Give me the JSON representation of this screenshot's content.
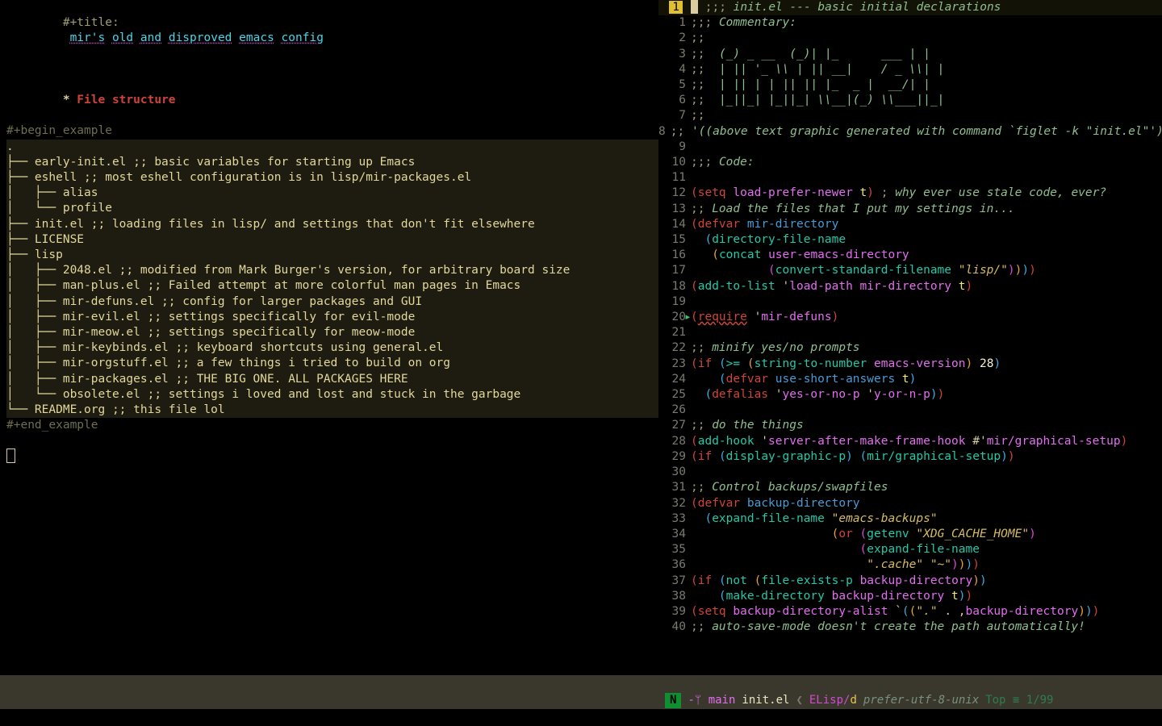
{
  "left": {
    "title_prefix": "#+title:",
    "title_words": [
      "mir's",
      "old",
      "and",
      "disproved",
      "emacs",
      "config"
    ],
    "heading_star": "*",
    "heading_text": " File structure",
    "begin_example": "#+begin_example",
    "end_example": "#+end_example",
    "example_lines": [
      ".",
      "├── early-init.el ;; basic variables for starting up Emacs",
      "├── eshell ;; most eshell configuration is in lisp/mir-packages.el",
      "│   ├── alias",
      "│   └── profile",
      "├── init.el ;; loading files in lisp/ and settings that don't fit elsewhere",
      "├── LICENSE",
      "├── lisp",
      "│   ├── 2048.el ;; modified from Mark Burger's version, for arbitrary board size",
      "│   ├── man-plus.el ;; Failed attempt at more colorful man pages in Emacs",
      "│   ├── mir-defuns.el ;; config for larger packages and GUI",
      "│   ├── mir-evil.el ;; settings specifically for evil-mode",
      "│   ├── mir-meow.el ;; settings specifically for meow-mode",
      "│   ├── mir-keybinds.el ;; keyboard shortcuts using general.el",
      "│   ├── mir-orgstuff.el ;; a few things i tried to build on org",
      "│   ├── mir-packages.el ;; THE BIG ONE. ALL PACKAGES HERE",
      "│   └── obsolete.el ;; settings i loved and lost and stuck in the garbage",
      "└── README.org ;; this file lol"
    ]
  },
  "right": {
    "header_badge": "1",
    "lines": [
      {
        "n": "1",
        "html": "<span class='comment2'>;;;</span> <span class='comment-it'>init.el --- basic initial declarations</span>"
      },
      {
        "n": "1",
        "html": "<span class='comment2'>;;;</span> <span class='comment-it'>Commentary:</span>"
      },
      {
        "n": "2",
        "html": "<span class='comment2'>;;</span>"
      },
      {
        "n": "3",
        "html": "<span class='comment2'>;;</span>  <span class='comment-it'>(_) _ __  (_)| |_      ___ | |</span>"
      },
      {
        "n": "4",
        "html": "<span class='comment2'>;;</span>  <span class='comment-it'>| || '_ \\\\ | || __|    / _ \\\\| |</span>"
      },
      {
        "n": "5",
        "html": "<span class='comment2'>;;</span>  <span class='comment-it'>| || | | || || |_  _ |  __/| |</span>"
      },
      {
        "n": "6",
        "html": "<span class='comment2'>;;</span>  <span class='comment-it'>|_||_| |_||_| \\\\__|(_) \\\\___||_|</span>"
      },
      {
        "n": "7",
        "html": "<span class='comment2'>;;</span>"
      },
      {
        "n": "8",
        "html": "<span class='comment2'>;;</span> <span class='comment-it'>'((above text graphic generated with command `figlet -k \"init.el\"'))</span>"
      },
      {
        "n": "9",
        "html": ""
      },
      {
        "n": "10",
        "html": "<span class='comment2'>;;;</span> <span class='comment-it'>Code:</span>"
      },
      {
        "n": "11",
        "html": ""
      },
      {
        "n": "12",
        "html": "<span class='paren1'>(</span><span class='kw'>setq</span> <span class='var'>load-prefer-newer</span> <span class='const'>t</span><span class='paren1'>)</span> <span class='comment2'>;</span> <span class='comment-it'>why ever use stale code, ever?</span>"
      },
      {
        "n": "13",
        "html": "<span class='comment2'>;;</span> <span class='comment-it'>Load the files that I put my settings in...</span>"
      },
      {
        "n": "14",
        "html": "<span class='paren1'>(</span><span class='kw'>defvar</span> <span class='fn'>mir-directory</span>"
      },
      {
        "n": "15",
        "html": "  <span class='paren2'>(</span><span class='type'>directory-file-name</span>"
      },
      {
        "n": "16",
        "html": "   <span class='paren3'>(</span><span class='type'>concat</span> <span class='var'>user-emacs-directory</span>"
      },
      {
        "n": "17",
        "html": "           <span class='paren4'>(</span><span class='type'>convert-standard-filename</span> <span class='string'>\"lisp/\"</span><span class='paren4'>)</span><span class='paren3'>)</span><span class='paren2'>)</span><span class='paren1'>)</span>"
      },
      {
        "n": "18",
        "html": "<span class='paren1'>(</span><span class='type'>add-to-list</span> '<span class='var'>load-path</span> <span class='var'>mir-directory</span> <span class='const'>t</span><span class='paren1'>)</span>"
      },
      {
        "n": "19",
        "html": ""
      },
      {
        "n": "20",
        "html": "<span class='paren1'>(</span><span class='kw err'>require</span> '<span class='var'>mir-defuns</span><span class='paren1'>)</span>",
        "arrow": true
      },
      {
        "n": "21",
        "html": ""
      },
      {
        "n": "22",
        "html": "<span class='comment2'>;;</span> <span class='comment-it'>minify yes/no prompts</span>"
      },
      {
        "n": "23",
        "html": "<span class='paren1'>(</span><span class='kw'>if</span> <span class='paren2'>(</span><span class='type'>&gt;=</span> <span class='paren3'>(</span><span class='type'>string-to-number</span> <span class='var'>emacs-version</span><span class='paren3'>)</span> <span class='num'>28</span><span class='paren2'>)</span>"
      },
      {
        "n": "24",
        "html": "    <span class='paren2'>(</span><span class='kw'>defvar</span> <span class='fn'>use-short-answers</span> <span class='const'>t</span><span class='paren2'>)</span>"
      },
      {
        "n": "25",
        "html": "  <span class='paren2'>(</span><span class='kw'>defalias</span> '<span class='var'>yes-or-no-p</span> '<span class='var'>y-or-n-p</span><span class='paren2'>)</span><span class='paren1'>)</span>"
      },
      {
        "n": "26",
        "html": ""
      },
      {
        "n": "27",
        "html": "<span class='comment2'>;;</span> <span class='comment-it'>do the things</span>"
      },
      {
        "n": "28",
        "html": "<span class='paren1'>(</span><span class='type'>add-hook</span> '<span class='var'>server-after-make-frame-hook</span> #'<span class='var'>mir/graphical-setup</span><span class='paren1'>)</span>"
      },
      {
        "n": "29",
        "html": "<span class='paren1'>(</span><span class='kw'>if</span> <span class='paren2'>(</span><span class='type'>display-graphic-p</span><span class='paren2'>)</span> <span class='paren2'>(</span><span class='type'>mir/graphical-setup</span><span class='paren2'>)</span><span class='paren1'>)</span>"
      },
      {
        "n": "30",
        "html": ""
      },
      {
        "n": "31",
        "html": "<span class='comment2'>;;</span> <span class='comment-it'>Control backups/swapfiles</span>"
      },
      {
        "n": "32",
        "html": "<span class='paren1'>(</span><span class='kw'>defvar</span> <span class='fn'>backup-directory</span>"
      },
      {
        "n": "33",
        "html": "  <span class='paren2'>(</span><span class='type'>expand-file-name</span> <span class='string'>\"emacs-backups\"</span>"
      },
      {
        "n": "34",
        "html": "                    <span class='paren3'>(</span><span class='kw'>or</span> <span class='paren4'>(</span><span class='type'>getenv</span> <span class='string'>\"XDG_CACHE_HOME\"</span><span class='paren4'>)</span>"
      },
      {
        "n": "35",
        "html": "                        <span class='paren4'>(</span><span class='type'>expand-file-name</span>"
      },
      {
        "n": "36",
        "html": "                         <span class='string'>\".cache\"</span> <span class='string'>\"~\"</span><span class='paren4'>)</span><span class='paren3'>)</span><span class='paren2'>)</span><span class='paren1'>)</span>"
      },
      {
        "n": "37",
        "html": "<span class='paren1'>(</span><span class='kw'>if</span> <span class='paren2'>(</span><span class='type'>not</span> <span class='paren3'>(</span><span class='type'>file-exists-p</span> <span class='var'>backup-directory</span><span class='paren3'>)</span><span class='paren2'>)</span>"
      },
      {
        "n": "38",
        "html": "    <span class='paren2'>(</span><span class='type'>make-directory</span> <span class='var'>backup-directory</span> <span class='const'>t</span><span class='paren2'>)</span><span class='paren1'>)</span>"
      },
      {
        "n": "39",
        "html": "<span class='paren1'>(</span><span class='kw'>setq</span> <span class='var'>backup-directory-alist</span> `<span class='paren2'>(</span><span class='paren3'>(</span><span class='string'>\".\"</span> . ,<span class='var'>backup-directory</span><span class='paren3'>)</span><span class='paren2'>)</span><span class='paren1'>)</span>"
      },
      {
        "n": "40",
        "html": "<span class='comment2'>;;</span> <span class='comment-it'>auto-save-mode doesn't create the path automatically!</span>"
      }
    ]
  },
  "status": {
    "n": "N",
    "git": "-ᛘ main",
    "file": "init.el",
    "mode_left": "ELisp",
    "mode_right": "d",
    "encoding": "prefer-utf-8-unix",
    "position": "Top ≡ 1/99"
  }
}
